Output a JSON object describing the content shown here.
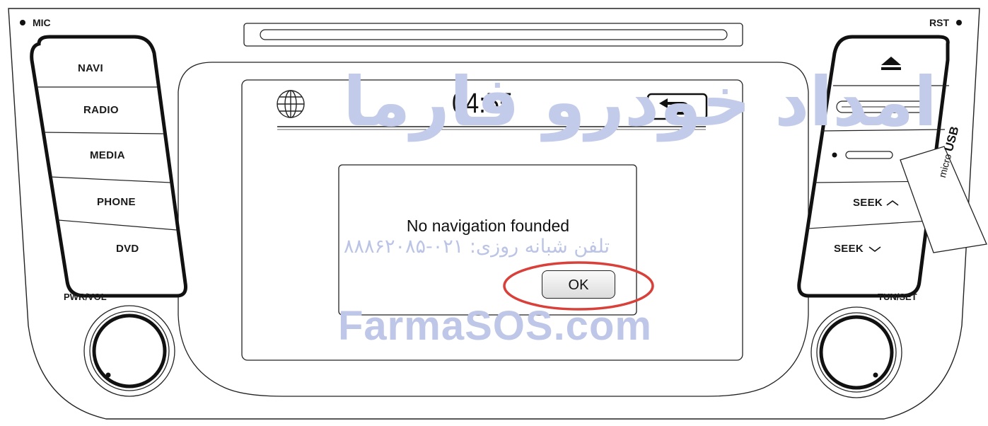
{
  "corner_labels": {
    "mic": "MIC",
    "rst": "RST"
  },
  "left_buttons": [
    {
      "name": "navi",
      "label": "NAVI"
    },
    {
      "name": "radio",
      "label": "RADIO"
    },
    {
      "name": "media",
      "label": "MEDIA"
    },
    {
      "name": "phone",
      "label": "PHONE"
    },
    {
      "name": "dvd",
      "label": "DVD"
    }
  ],
  "right_buttons": {
    "eject_icon": "eject-icon",
    "seek_up": "SEEK",
    "seek_down": "SEEK"
  },
  "knobs": {
    "left": "PWR/VOL",
    "right": "TUN/SET"
  },
  "screen": {
    "clock": "04:55",
    "globe_icon": "globe-icon",
    "back_icon": "back-arrow-icon"
  },
  "dialog": {
    "message": "No navigation founded",
    "ok_label": "OK"
  },
  "usb_tag": {
    "micro": "micro",
    "usb": "USB"
  },
  "watermark": {
    "site": "FarmaSOS.com",
    "persian_name": "امداد خودرو فارما",
    "phone": "تلفن شبانه روزی: ۰۲۱-۸۸۸۶۲۰۸۵"
  },
  "colors": {
    "highlight_ring": "#d9403a",
    "watermark": "#bfc7e8"
  }
}
